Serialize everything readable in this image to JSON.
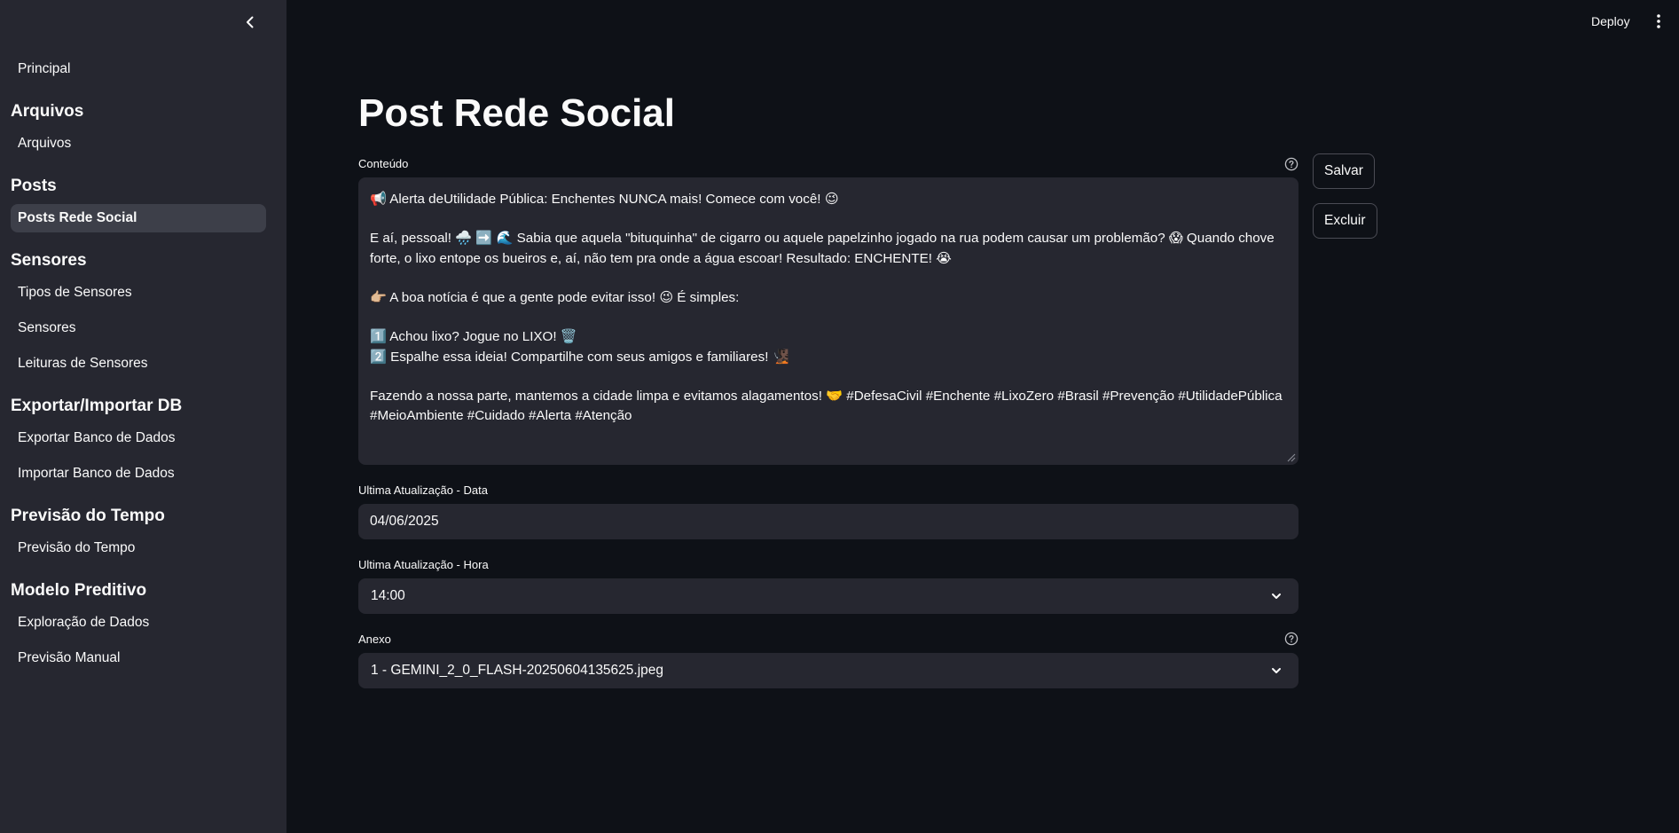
{
  "topbar": {
    "deploy_label": "Deploy"
  },
  "sidebar": {
    "top_item": "Principal",
    "groups": [
      {
        "title": "Arquivos",
        "items": [
          "Arquivos"
        ]
      },
      {
        "title": "Posts",
        "items": [
          "Posts Rede Social"
        ]
      },
      {
        "title": "Sensores",
        "items": [
          "Tipos de Sensores",
          "Sensores",
          "Leituras de Sensores"
        ]
      },
      {
        "title": "Exportar/Importar DB",
        "items": [
          "Exportar Banco de Dados",
          "Importar Banco de Dados"
        ]
      },
      {
        "title": "Previsão do Tempo",
        "items": [
          "Previsão do Tempo"
        ]
      },
      {
        "title": "Modelo Preditivo",
        "items": [
          "Exploração de Dados",
          "Previsão Manual"
        ]
      }
    ],
    "active_item": "Posts Rede Social"
  },
  "main": {
    "title": "Post Rede Social",
    "content_label": "Conteúdo",
    "content_value": "📢 Alerta deUtilidade Pública: Enchentes NUNCA mais! Comece com você! 😉\n\nE aí, pessoal! 🌧️ ➡️ 🌊 Sabia que aquela \"bituquinha\" de cigarro ou aquele papelzinho jogado na rua podem causar um problemão? 😱 Quando chove forte, o lixo entope os bueiros e, aí, não tem pra onde a água escoar! Resultado: ENCHENTE! 😭\n\n👉🏼 A boa notícia é que a gente pode evitar isso! 😉 É simples:\n\n1️⃣ Achou lixo? Jogue no LIXO! 🗑️\n2️⃣ Espalhe essa ideia! Compartilhe com seus amigos e familiares! 🧏🏿\n\nFazendo a nossa parte, mantemos a cidade limpa e evitamos alagamentos! 🤝 #DefesaCivil #Enchente #LixoZero #Brasil #Prevenção #UtilidadePública #MeioAmbiente #Cuidado #Alerta #Atenção",
    "date_label": "Ultima Atualização - Data",
    "date_value": "04/06/2025",
    "time_label": "Ultima Atualização - Hora",
    "time_value": "14:00",
    "attachment_label": "Anexo",
    "attachment_value": "1 - GEMINI_2_0_FLASH-20250604135625.jpeg",
    "save_label": "Salvar",
    "delete_label": "Excluir"
  },
  "colors": {
    "background": "#0e1117",
    "sidebar": "#262730",
    "active_item": "#3d3f49",
    "text": "#fafafa"
  }
}
